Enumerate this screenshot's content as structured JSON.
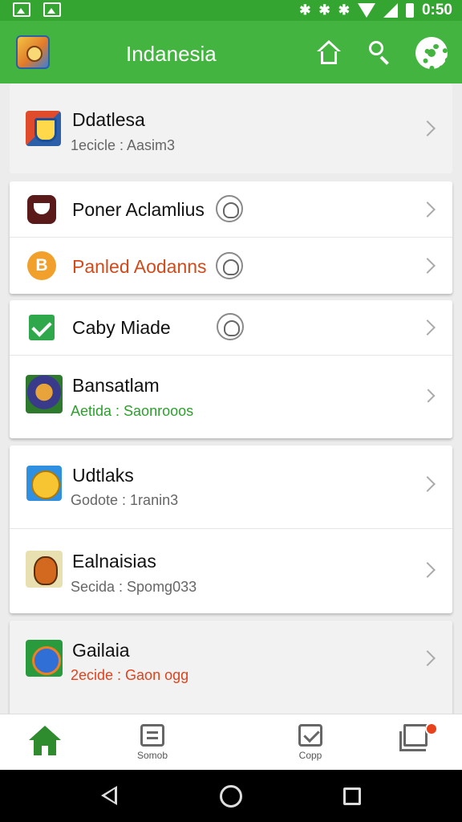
{
  "status_bar": {
    "time": "0:50"
  },
  "app_bar": {
    "title": "Indanesia"
  },
  "accent": "#44b441",
  "cards": [
    {
      "rows": [
        {
          "title": "Ddatlesa",
          "subtitle": "1ecicle : Aasim3"
        }
      ]
    },
    {
      "rows": [
        {
          "title": "Poner Aclamlius"
        },
        {
          "title": "Panled Aodanns",
          "title_color": "#d14a1a"
        }
      ]
    },
    {
      "rows": [
        {
          "title": "Caby Miade"
        },
        {
          "title": "Bansatlam",
          "subtitle": "Aetida : Saonrooos",
          "subtitle_color": "#2e9e2e"
        }
      ]
    },
    {
      "rows": [
        {
          "title": "Udtlaks",
          "subtitle": "Godote : 1ranin3"
        },
        {
          "title": "Ealnaisias",
          "subtitle": "Secida : Spomg033"
        }
      ]
    },
    {
      "rows": [
        {
          "title": "Gailaia",
          "subtitle": "2ecide : Gaon ogg",
          "subtitle_color": "#e0431c"
        }
      ]
    }
  ],
  "bottom_nav": {
    "items": [
      {
        "label": ""
      },
      {
        "label": "Somob"
      },
      {
        "label": "Copp"
      },
      {
        "label": ""
      }
    ]
  }
}
